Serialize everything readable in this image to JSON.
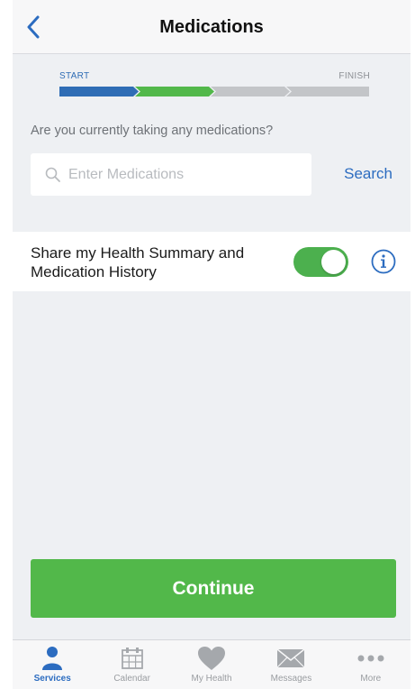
{
  "header": {
    "title": "Medications",
    "back_icon": "chevron-left-icon"
  },
  "progress": {
    "start_label": "START",
    "finish_label": "FINISH",
    "steps": [
      {
        "state": "complete",
        "color": "#2f6db5"
      },
      {
        "state": "current",
        "color": "#52b84a"
      },
      {
        "state": "pending",
        "color": "#c3c5c8"
      },
      {
        "state": "pending",
        "color": "#c3c5c8"
      }
    ]
  },
  "medications": {
    "question": "Are you currently taking any medications?",
    "search_placeholder": "Enter Medications",
    "search_icon": "search-icon",
    "search_button": "Search"
  },
  "share": {
    "label": "Share my Health Summary and Medication History",
    "toggle_on": true,
    "info_icon": "info-icon"
  },
  "continue_label": "Continue",
  "tabbar": {
    "tabs": [
      {
        "label": "Services",
        "icon": "person-icon",
        "active": true
      },
      {
        "label": "Calendar",
        "icon": "calendar-icon",
        "active": false
      },
      {
        "label": "My Health",
        "icon": "heart-icon",
        "active": false
      },
      {
        "label": "Messages",
        "icon": "envelope-icon",
        "active": false
      },
      {
        "label": "More",
        "icon": "more-icon",
        "active": false
      }
    ]
  },
  "colors": {
    "accent_blue": "#2c6cc0",
    "accent_green": "#52b84a",
    "background": "#eef0f3"
  }
}
